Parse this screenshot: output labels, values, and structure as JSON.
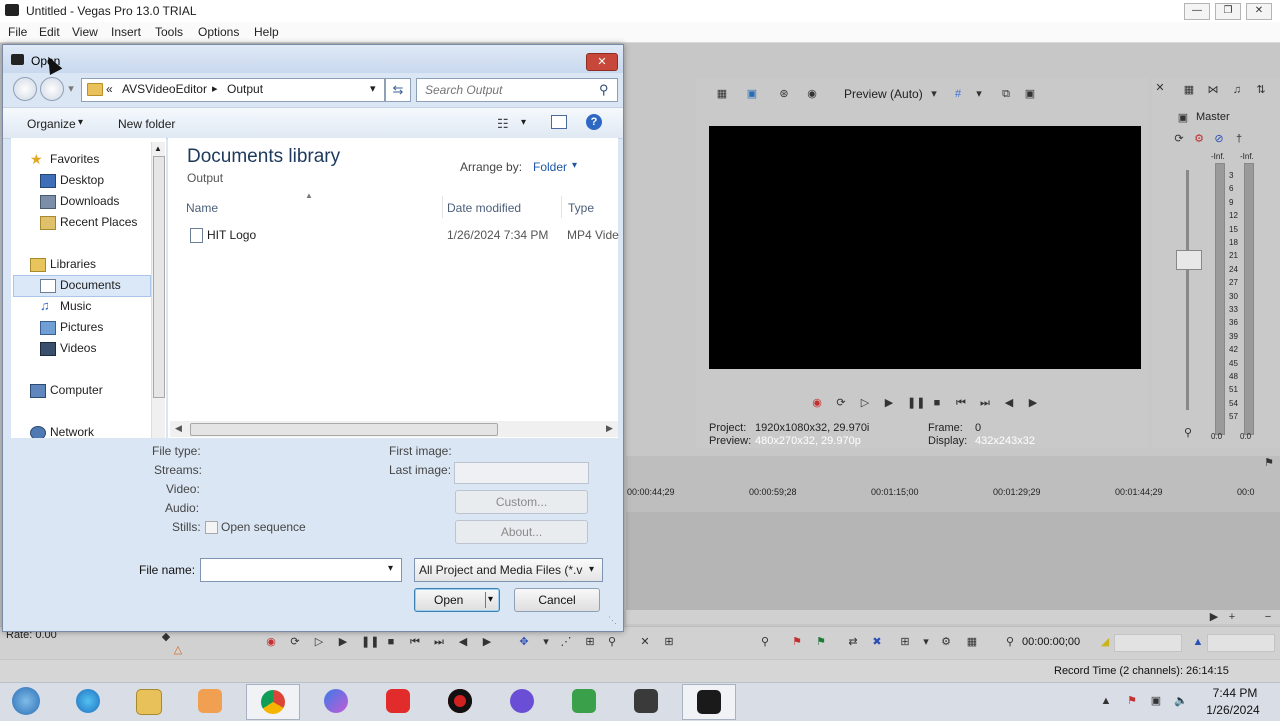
{
  "app": {
    "title": "Untitled - Vegas Pro 13.0 TRIAL",
    "menu": [
      "File",
      "Edit",
      "View",
      "Insert",
      "Tools",
      "Options",
      "Help"
    ]
  },
  "preview": {
    "mode_label": "Preview (Auto)",
    "project_label": "Project:",
    "project_value": "1920x1080x32, 29.970i",
    "preview_label": "Preview:",
    "preview_value": "480x270x32, 29.970p",
    "frame_label": "Frame:",
    "frame_value": "0",
    "display_label": "Display:",
    "display_value": "432x243x32"
  },
  "mixer": {
    "master_label": "Master",
    "peak_left": "-Inf.",
    "peak_right": "-Inf.",
    "db_scale": [
      "3",
      "6",
      "9",
      "12",
      "15",
      "18",
      "21",
      "24",
      "27",
      "30",
      "33",
      "36",
      "39",
      "42",
      "45",
      "48",
      "51",
      "54",
      "57"
    ],
    "bottom_left": "0.0",
    "bottom_right": "0.0"
  },
  "timeline": {
    "timecodes": [
      "00:00:44;29",
      "00:00:59;28",
      "00:01:15;00",
      "00:01:29;29",
      "00:01:44;29",
      "00:0"
    ]
  },
  "transport": {
    "rate": "Rate: 0.00",
    "timecode": "00:00:00;00",
    "record_time": "Record Time (2 channels): 26:14:15"
  },
  "dialog": {
    "title": "Open",
    "breadcrumb": [
      "«",
      "AVSVideoEditor",
      "Output"
    ],
    "search_placeholder": "Search Output",
    "organize_label": "Organize",
    "new_folder_label": "New folder",
    "nav": {
      "favorites": "Favorites",
      "desktop": "Desktop",
      "downloads": "Downloads",
      "recent": "Recent Places",
      "libraries": "Libraries",
      "documents": "Documents",
      "music": "Music",
      "pictures": "Pictures",
      "videos": "Videos",
      "computer": "Computer",
      "network": "Network"
    },
    "library_title": "Documents library",
    "library_subtitle": "Output",
    "arrange_label": "Arrange by:",
    "arrange_value": "Folder",
    "columns": {
      "name": "Name",
      "date": "Date modified",
      "type": "Type"
    },
    "files": [
      {
        "name": "HIT Logo",
        "date": "1/26/2024 7:34 PM",
        "type": "MP4 Vide"
      }
    ],
    "details": {
      "file_type": "File type:",
      "streams": "Streams:",
      "video": "Video:",
      "audio": "Audio:",
      "stills": "Stills:",
      "open_sequence": "Open sequence",
      "first_image": "First image:",
      "last_image": "Last image:",
      "custom": "Custom...",
      "about": "About..."
    },
    "file_name_label": "File name:",
    "file_name_value": "",
    "file_type_value": "All Project and Media Files (*.ve",
    "open_label": "Open",
    "cancel_label": "Cancel"
  },
  "taskbar": {
    "time": "7:44 PM",
    "date": "1/26/2024"
  },
  "colors": {
    "dialog_bg": "#dbe6f4",
    "library_title": "#1e395b",
    "close_red": "#c7473a"
  }
}
